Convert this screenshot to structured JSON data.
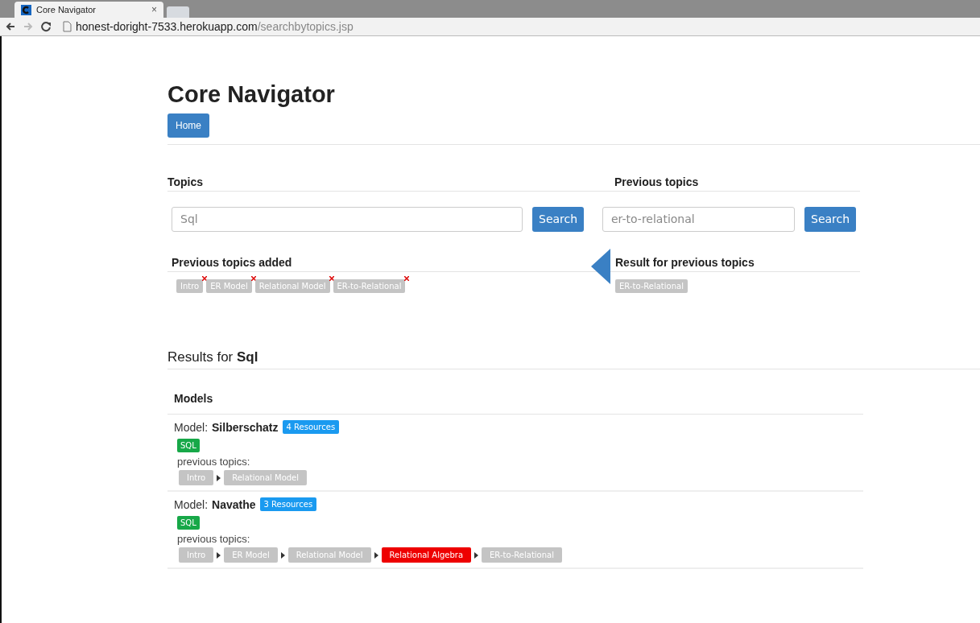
{
  "browser": {
    "tab_title": "Core Navigator",
    "tab_close": "×",
    "url_host": "honest-doright-7533.herokuapp.com",
    "url_path": "/searchbytopics.jsp"
  },
  "page": {
    "title": "Core Navigator",
    "nav": [
      {
        "label": "Home",
        "selected": true
      }
    ]
  },
  "topics": {
    "heading": "Topics",
    "input_value": "Sql",
    "button": "Search",
    "added_heading": "Previous topics added",
    "added": [
      {
        "label": "Intro"
      },
      {
        "label": "ER Model"
      },
      {
        "label": "Relational Model"
      },
      {
        "label": "ER-to-Relational"
      }
    ]
  },
  "previous": {
    "heading": "Previous topics",
    "input_value": "er-to-relational",
    "button": "Search",
    "result_heading": "Result for previous topics",
    "results": [
      {
        "label": "ER-to-Relational"
      }
    ]
  },
  "results": {
    "prefix": "Results for",
    "query": "Sql",
    "section": "Models",
    "models": [
      {
        "label": "Model:",
        "name": "Silberschatz",
        "resources": "4 Resources",
        "tag": "SQL",
        "path_label": "previous topics:",
        "path": [
          {
            "label": "Intro",
            "highlighted": false
          },
          {
            "label": "Relational Model",
            "highlighted": false
          }
        ]
      },
      {
        "label": "Model:",
        "name": "Navathe",
        "resources": "3 Resources",
        "tag": "SQL",
        "path_label": "previous topics:",
        "path": [
          {
            "label": "Intro",
            "highlighted": false
          },
          {
            "label": "ER Model",
            "highlighted": false
          },
          {
            "label": "Relational Model",
            "highlighted": false
          },
          {
            "label": "Relational Algebra",
            "highlighted": true
          },
          {
            "label": "ER-to-Relational",
            "highlighted": false
          }
        ]
      }
    ]
  }
}
